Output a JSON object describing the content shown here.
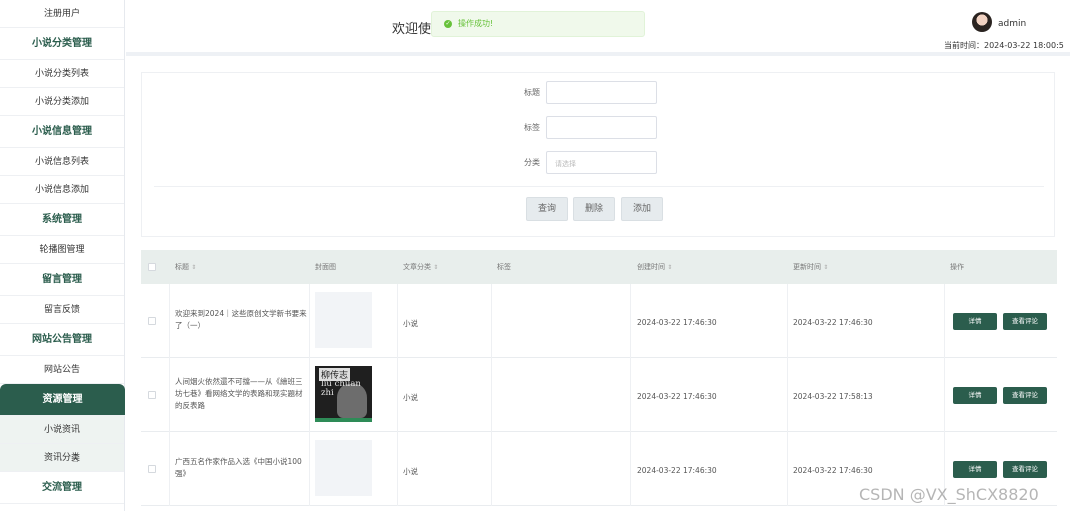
{
  "sidebar": {
    "items": [
      {
        "type": "sub",
        "label": "注册用户"
      },
      {
        "type": "head",
        "label": "小说分类管理"
      },
      {
        "type": "sub",
        "label": "小说分类列表"
      },
      {
        "type": "sub",
        "label": "小说分类添加"
      },
      {
        "type": "head",
        "label": "小说信息管理"
      },
      {
        "type": "sub",
        "label": "小说信息列表"
      },
      {
        "type": "sub",
        "label": "小说信息添加"
      },
      {
        "type": "head",
        "label": "系统管理"
      },
      {
        "type": "sub",
        "label": "轮播图管理"
      },
      {
        "type": "head",
        "label": "留言管理"
      },
      {
        "type": "sub",
        "label": "留言反馈"
      },
      {
        "type": "head",
        "label": "网站公告管理"
      },
      {
        "type": "sub",
        "label": "网站公告"
      },
      {
        "type": "head",
        "label": "资源管理",
        "active": true
      },
      {
        "type": "sub",
        "label": "小说资讯"
      },
      {
        "type": "sub",
        "label": "资讯分类",
        "selected": true
      },
      {
        "type": "head",
        "label": "交流管理"
      }
    ]
  },
  "header": {
    "welcome": "欢迎使",
    "toast": "操作成功!",
    "username": "admin",
    "time": "当前时间：2024-03-22 18:00:5"
  },
  "search": {
    "title_label": "标题",
    "tag_label": "标签",
    "category_label": "分类",
    "category_placeholder": "请选择",
    "query_btn": "查询",
    "delete_btn": "删除",
    "add_btn": "添加"
  },
  "table": {
    "headers": {
      "title": "标题",
      "cover": "封面图",
      "category": "文章分类",
      "tags": "标签",
      "created": "创建时间",
      "updated": "更新时间",
      "actions": "操作"
    },
    "rows": [
      {
        "title": "欢迎来到2024｜这些原创文学新书要来了（一）",
        "category": "小说",
        "created": "2024-03-22 17:46:30",
        "updated": "2024-03-22 17:46:30",
        "detail": "详情",
        "comments": "查看评论",
        "cover": "blank"
      },
      {
        "title": "人间烟火依然還不可擋——从《繪班三坊七巷》看网络文学的表路和现实題材的反表路",
        "category": "小说",
        "created": "2024-03-22 17:46:30",
        "updated": "2024-03-22 17:58:13",
        "detail": "详情",
        "comments": "查看评论",
        "cover": "book",
        "cover_title": "柳传志",
        "cover_name": "liu chuan zhi"
      },
      {
        "title": "广西五名作家作品入选《中国小说100强》",
        "category": "小说",
        "created": "2024-03-22 17:46:30",
        "updated": "2024-03-22 17:46:30",
        "detail": "详情",
        "comments": "查看评论",
        "cover": "blank"
      }
    ]
  },
  "watermark": "CSDN @VX_ShCX8820"
}
